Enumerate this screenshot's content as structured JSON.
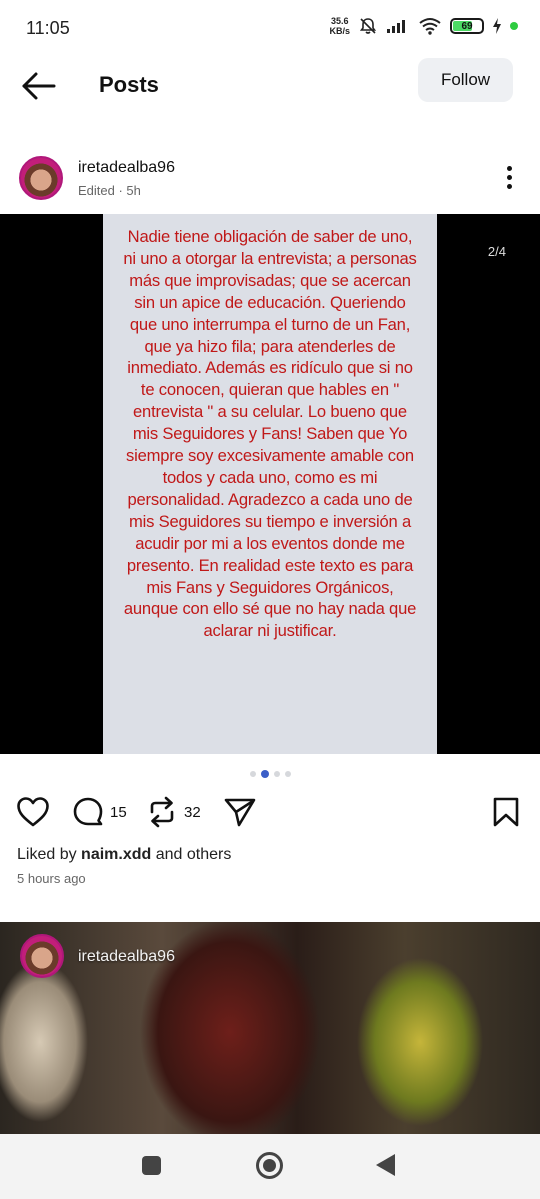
{
  "status_bar": {
    "time": "11:05",
    "net_speed_value": "35.6",
    "net_speed_unit": "KB/s",
    "battery_level": "69",
    "battery_percent": 69
  },
  "header": {
    "back_icon": "arrow-left-icon",
    "title": "Posts",
    "follow_label": "Follow"
  },
  "post": {
    "username": "iretadealba96",
    "meta": "Edited · 5h",
    "slide_counter": "2/4",
    "slide_index": 2,
    "slide_total": 4,
    "story_text": "Nadie tiene obligación de saber de uno, ni uno a otorgar la entrevista; a personas más que improvisadas; que se acercan sin un apice de educación. Queriendo que uno interrumpa el turno de un Fan, que ya hizo fila; para atenderles de inmediato. Además es ridículo que si no te conocen, quieran que hables en \" entrevista \" a su celular. Lo bueno que mis Seguidores y Fans! Saben que Yo siempre soy excesivamente amable con todos y cada uno, como es mi personalidad. Agradezco a cada uno de mis Seguidores su tiempo e inversión a acudir por mi a los eventos donde me presento. En realidad este texto es para mis Fans y Seguidores Orgánicos, aunque con ello sé que no hay nada que aclarar ni justificar.",
    "comments_count": "15",
    "reposts_count": "32",
    "liked_by_prefix": "Liked by ",
    "liked_by_user": "naim.xdd",
    "liked_by_suffix": " and others",
    "time_ago": "5 hours ago"
  },
  "next_post": {
    "username": "iretadealba96"
  },
  "colors": {
    "story_text": "#c01818",
    "story_bg": "#dcdfe6",
    "active_dot": "#3b5ec7",
    "follow_bg": "#eef0f3"
  },
  "icons": [
    "arrow-left-icon",
    "more-vertical-icon",
    "heart-icon",
    "comment-icon",
    "repost-icon",
    "send-icon",
    "bookmark-icon",
    "recents-icon",
    "home-icon",
    "back-triangle-icon"
  ]
}
